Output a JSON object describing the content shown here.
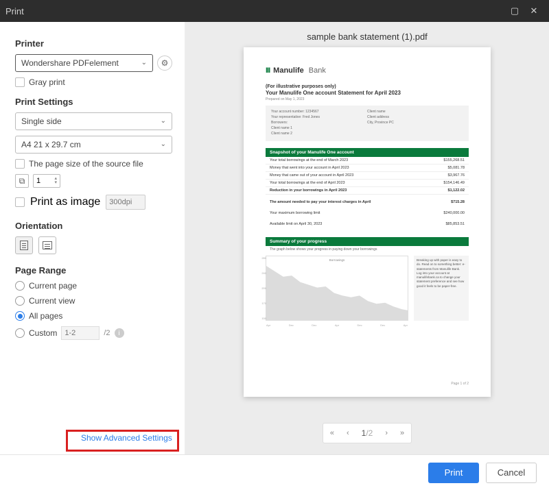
{
  "window": {
    "title": "Print"
  },
  "printer": {
    "label": "Printer",
    "selected": "Wondershare PDFelement",
    "gray_print": "Gray print"
  },
  "print_settings": {
    "label": "Print Settings",
    "sides": "Single side",
    "paper": "A4 21 x 29.7 cm",
    "source_size": "The page size of the source file",
    "copies": "1",
    "print_as_image": "Print as image",
    "dpi_placeholder": "300dpi"
  },
  "orientation": {
    "label": "Orientation"
  },
  "page_range": {
    "label": "Page Range",
    "current_page": "Current page",
    "current_view": "Current view",
    "all_pages": "All pages",
    "custom": "Custom",
    "range_placeholder": "1-2",
    "of": "/2"
  },
  "advanced": "Show Advanced Settings",
  "preview": {
    "filename": "sample bank statement (1).pdf",
    "brand": "Manulife",
    "brand_sub": "Bank",
    "illustrative": "(For illustrative purposes only)",
    "statement_title": "Your Manulife One account Statement for April 2023",
    "prepared": "Prepared on May 1, 2023",
    "acct_left": [
      "Your account number: 1234567",
      "Your representative: Fred Jones",
      "",
      "Borrowers:",
      "Client name 1",
      "Client name 2"
    ],
    "acct_right": [
      "Client name",
      "Client address",
      "City, Province PC"
    ],
    "snapshot_header": "Snapshot of your Manulife One account",
    "snapshot_rows": [
      [
        "Your total borrowings at the end of March 2023",
        "$155,268.51"
      ],
      [
        "Money that went into your account in April 2023",
        "$5,081.78"
      ],
      [
        "Money that came out of your account in April 2023",
        "$3,967.76"
      ],
      [
        "Your total borrowings at the end of April 2023",
        "$154,146.49"
      ],
      [
        "Reduction in your borrowings in April 2023",
        "$1,122.02"
      ]
    ],
    "interest_row": [
      "The amount needed to pay your interest charges in April",
      "$715.28"
    ],
    "limit_row": [
      "Your maximum borrowing limit",
      "$240,000.00"
    ],
    "avail_row": [
      "Available limit on April 30, 2023",
      "$85,853.51"
    ],
    "progress_header": "Summary of your progress",
    "progress_sub": "The graph below shows your progress in paying down your borrowings",
    "note": "Breaking up with paper is easy to do. Read on to something better: e-statements from Manulife Bank. Log into your account at manulifebank.ca to change your statement preference and see how good it feels to be paper-free.",
    "page_of": "Page 1 of 2"
  },
  "pager": {
    "current": "1",
    "total": "/2"
  },
  "footer": {
    "print": "Print",
    "cancel": "Cancel"
  },
  "chart_data": {
    "type": "area",
    "title": "Borrowings",
    "x": [
      "Apr",
      "Dec",
      "Dec",
      "Apr",
      "Dec",
      "Dec",
      "Apr"
    ],
    "y_ticks": [
      280,
      260,
      240,
      220,
      200,
      180,
      170,
      160,
      150
    ],
    "series": [
      {
        "name": "Borrowings",
        "values": [
          260,
          245,
          230,
          225,
          210,
          200,
          195,
          200,
          185,
          175,
          178,
          165,
          160,
          162,
          155,
          154
        ]
      }
    ]
  }
}
